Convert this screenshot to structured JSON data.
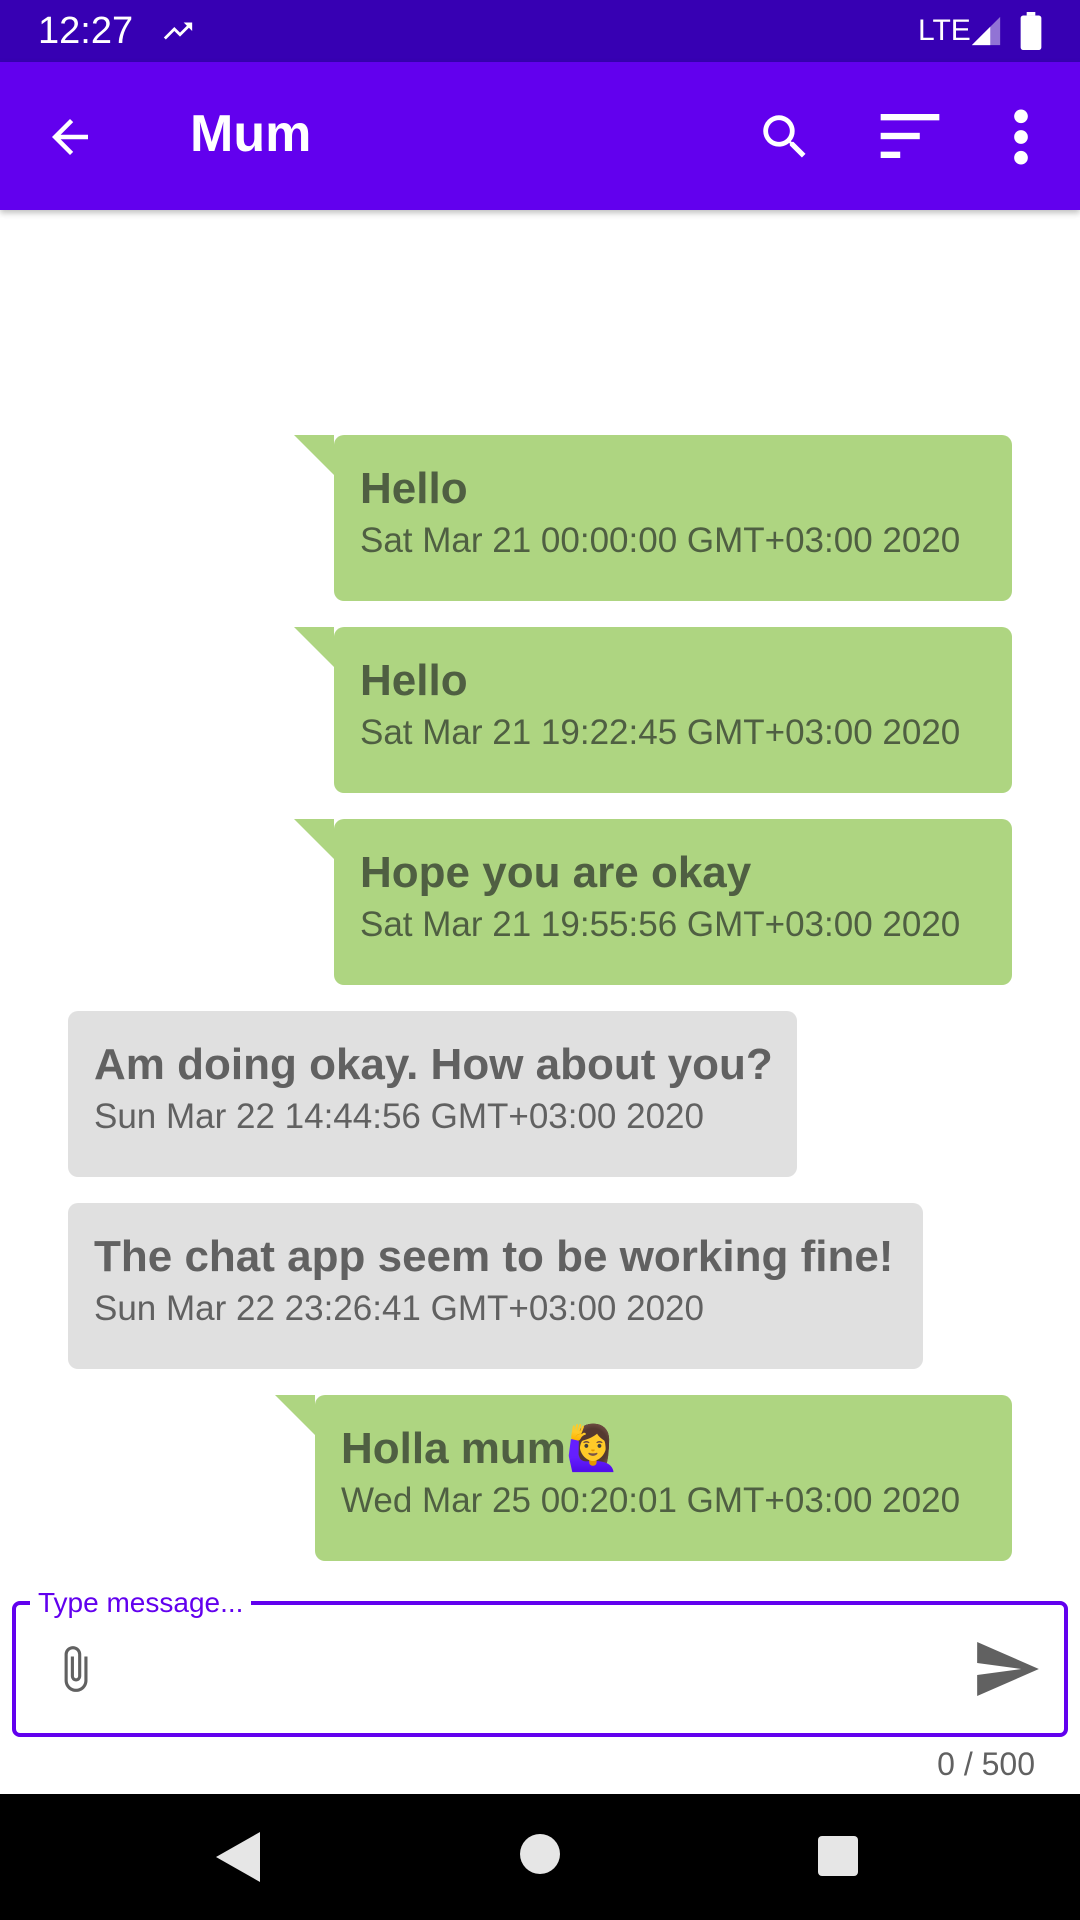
{
  "status_bar": {
    "time": "12:27",
    "network": "LTE",
    "icons": [
      "trending-up-icon",
      "signal-icon",
      "battery-icon"
    ]
  },
  "app_bar": {
    "title": "Mum",
    "icons": [
      "back-arrow-icon",
      "search-icon",
      "sort-icon",
      "more-vert-icon"
    ]
  },
  "messages": [
    {
      "direction": "sent",
      "text": "Hello",
      "timestamp": "Sat Mar 21 00:00:00 GMT+03:00 2020"
    },
    {
      "direction": "sent",
      "text": "Hello",
      "timestamp": "Sat Mar 21 19:22:45 GMT+03:00 2020"
    },
    {
      "direction": "sent",
      "text": "Hope you are okay",
      "timestamp": "Sat Mar 21 19:55:56 GMT+03:00 2020"
    },
    {
      "direction": "received",
      "text": "Am doing okay. How about you?",
      "timestamp": "Sun Mar 22 14:44:56 GMT+03:00 2020"
    },
    {
      "direction": "received",
      "text": "The chat app seem to be working fine!",
      "timestamp": "Sun Mar 22 23:26:41 GMT+03:00 2020"
    },
    {
      "direction": "sent",
      "text": "Holla mum🙋‍♀️",
      "timestamp": "Wed Mar 25 00:20:01 GMT+03:00 2020"
    }
  ],
  "composer": {
    "label": "Type message...",
    "value": "",
    "counter": "0 / 500",
    "icons": [
      "attach-icon",
      "send-icon"
    ]
  },
  "nav_bar": {
    "icons": [
      "nav-back-icon",
      "nav-home-icon",
      "nav-recents-icon"
    ]
  },
  "colors": {
    "status_bar": "#3700b3",
    "app_bar": "#6200ee",
    "sent_bubble": "#aed581",
    "received_bubble": "#e0e0e0",
    "accent": "#6200ee"
  }
}
